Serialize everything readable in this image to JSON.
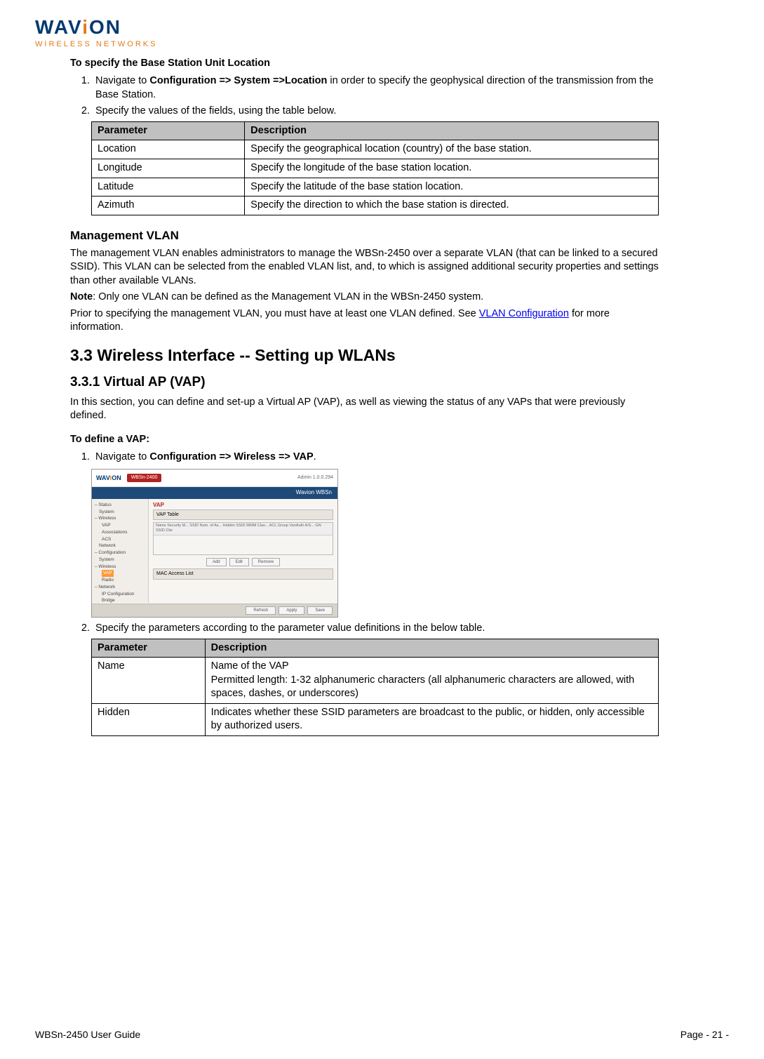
{
  "logo": {
    "main_pre": "WAV",
    "main_mid": "i",
    "main_post": "ON",
    "sub": "WIRELESS NETWORKS"
  },
  "section1": {
    "heading": "To specify the Base Station Unit Location",
    "step1_pre": "Navigate to ",
    "step1_bold": "Configuration => System =>Location",
    "step1_post": " in order to specify the geophysical direction of the transmission from the Base Station.",
    "step2": "Specify the values of the fields, using the table below."
  },
  "table1": {
    "headers": [
      "Parameter",
      "Description"
    ],
    "rows": [
      [
        "Location",
        "Specify the geographical location (country) of the base station."
      ],
      [
        "Longitude",
        "Specify the longitude of the base station location."
      ],
      [
        "Latitude",
        "Specify the latitude of the base station location."
      ],
      [
        "Azimuth",
        "Specify the direction to which the base station is directed."
      ]
    ]
  },
  "section2": {
    "heading": "Management VLAN",
    "p1": "The management VLAN enables administrators to manage the WBSn-2450 over a separate VLAN (that can be linked to a secured SSID). This VLAN can be selected from the enabled VLAN list, and, to which is assigned additional security properties and settings than other available VLANs.",
    "note_label": "Note",
    "note_text": ": Only one VLAN can be defined as the Management VLAN in the WBSn-2450 system.",
    "p3_pre": "Prior to specifying the management VLAN, you must have at least one VLAN defined. See ",
    "p3_link": "VLAN Configuration",
    "p3_post": " for more information."
  },
  "section3": {
    "h1": "3.3  Wireless Interface -- Setting up WLANs",
    "h2": "3.3.1      Virtual AP (VAP)",
    "p1": "In this section, you can define and set-up a Virtual AP (VAP), as well as viewing the status of any VAPs that were previously defined.",
    "sub_heading": "To define a VAP:",
    "step1_pre": "Navigate to ",
    "step1_bold": "Configuration => Wireless => VAP",
    "step1_post": ".",
    "step2": "Specify the parameters according to the parameter value definitions in the below table."
  },
  "screenshot": {
    "badge": "WBSn-2400",
    "admin": "Admin 1.0.0.294",
    "header": "Wavion WBSn",
    "sidebar": [
      "– Status",
      "System",
      "– Wireless",
      "VAP",
      "Associations",
      "ACS",
      "Network",
      "– Configuration",
      "System",
      "– Wireless",
      "VAP",
      "Radio",
      "– Network",
      "IP Configuration",
      "Bridge"
    ],
    "main_title": "VAP",
    "tab1": "VAP Table",
    "cols": "Name  Security M...  SSID  Num. of As...  Hidden SSID  WMM Clas...  ACL Group  VanAuth A/S...  GN SSID  Clie",
    "btn_add": "Add",
    "btn_edit": "Edit",
    "btn_remove": "Remove",
    "tab2": "MAC Access List",
    "btn_refresh": "Refresh",
    "btn_apply": "Apply",
    "btn_save": "Save"
  },
  "table2": {
    "headers": [
      "Parameter",
      "Description"
    ],
    "rows": [
      {
        "p": "Name",
        "d1": "Name of the VAP",
        "d2": "Permitted length: 1-32 alphanumeric characters (all alphanumeric characters are allowed, with spaces, dashes, or underscores)"
      },
      {
        "p": "Hidden",
        "d1": "Indicates whether these SSID parameters are broadcast to the public, or hidden, only accessible by authorized users."
      }
    ]
  },
  "footer": {
    "left": "WBSn-2450 User Guide",
    "right": "Page - 21 -"
  }
}
